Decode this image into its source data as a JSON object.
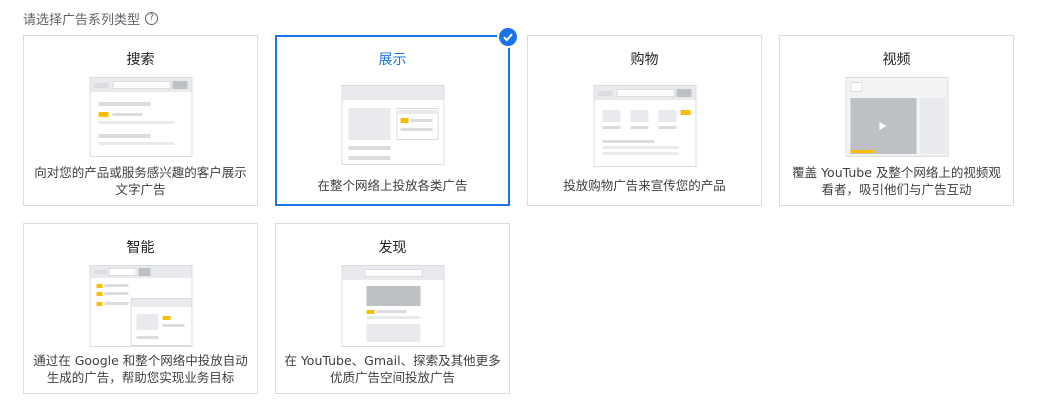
{
  "header": {
    "title": "请选择广告系列类型",
    "help_icon": "help-circle-icon"
  },
  "cards": [
    {
      "title": "搜索",
      "desc": "向对您的产品或服务感兴趣的客户展示文字广告",
      "selected": false,
      "illustration": "search-ad-illustration"
    },
    {
      "title": "展示",
      "desc": "在整个网络上投放各类广告",
      "selected": true,
      "illustration": "display-ad-illustration"
    },
    {
      "title": "购物",
      "desc": "投放购物广告来宣传您的产品",
      "selected": false,
      "illustration": "shopping-ad-illustration"
    },
    {
      "title": "视频",
      "desc": "覆盖 YouTube 及整个网络上的视频观看者，吸引他们与广告互动",
      "selected": false,
      "illustration": "video-ad-illustration"
    },
    {
      "title": "智能",
      "desc": "通过在 Google 和整个网络中投放自动生成的广告，帮助您实现业务目标",
      "selected": false,
      "illustration": "smart-ad-illustration"
    },
    {
      "title": "发现",
      "desc": "在 YouTube、Gmail、探索及其他更多优质广告空间投放广告",
      "selected": false,
      "illustration": "discovery-ad-illustration"
    }
  ],
  "colors": {
    "accent": "#1a73e8",
    "highlight": "#fbbc04"
  }
}
